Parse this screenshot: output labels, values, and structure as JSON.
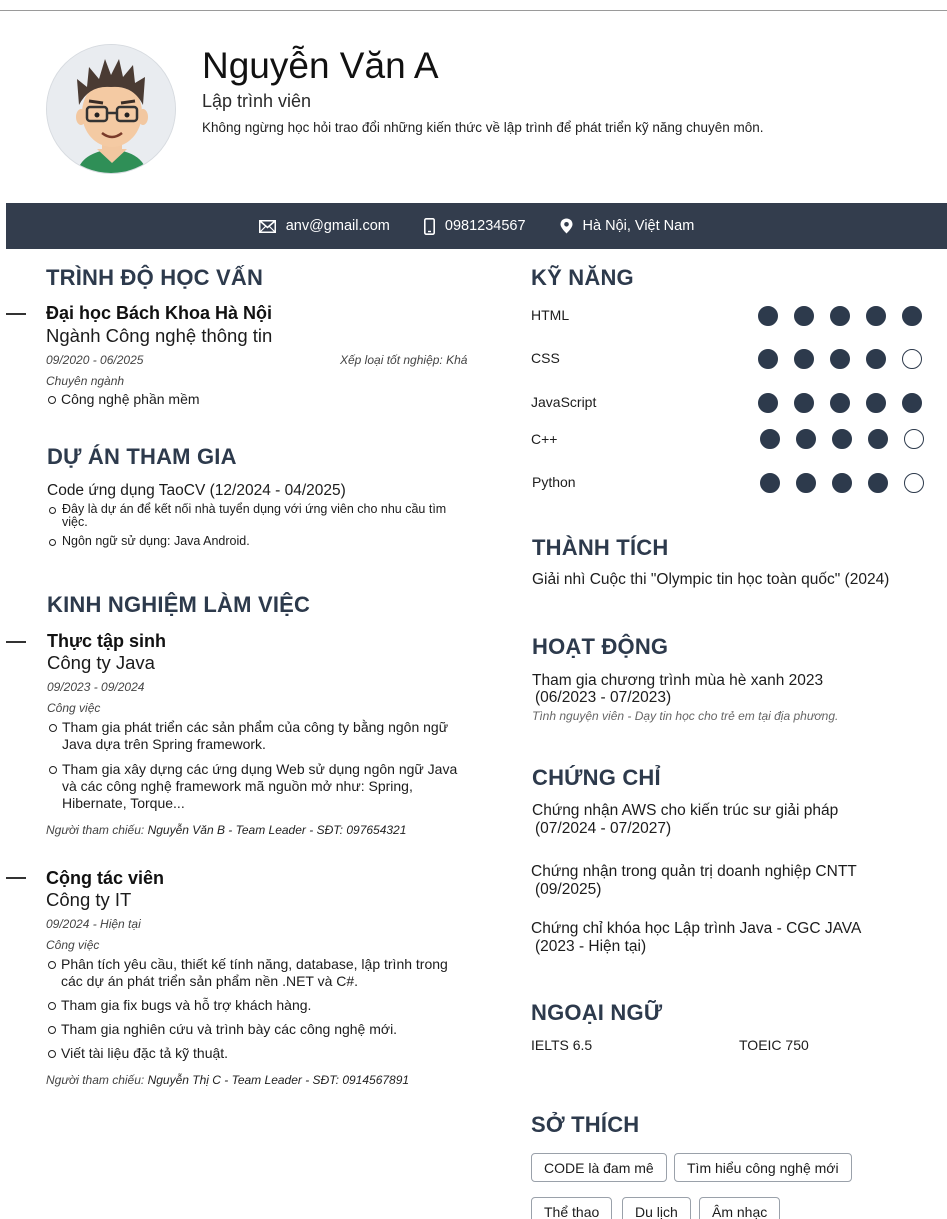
{
  "profile": {
    "name": "Nguyễn Văn A",
    "title": "Lập trình viên",
    "summary": "Không ngừng học hỏi trao đổi những kiến thức về lập trình để phát triển kỹ năng chuyên môn."
  },
  "contact": {
    "email": "anv@gmail.com",
    "phone": "0981234567",
    "location": "Hà Nội, Việt Nam",
    "email_icon": "mail-icon",
    "phone_icon": "phone-icon",
    "location_icon": "map-pin-icon"
  },
  "education": {
    "heading": "TRÌNH ĐỘ HỌC VẤN",
    "school": "Đại học Bách Khoa Hà Nội",
    "major": "Ngành Công nghệ thông tin",
    "period": "09/2020 - 06/2025",
    "grade": "Xếp loại tốt nghiệp: Khá",
    "specialty_label": "Chuyên ngành",
    "specialties": [
      "Công nghệ phần mềm"
    ]
  },
  "projects": {
    "heading": "DỰ ÁN THAM GIA",
    "items": [
      {
        "title": "Code ứng dụng TaoCV (12/2024 - 04/2025)",
        "bullets": [
          "Đây là dự án để kết nối nhà tuyển dụng với ứng viên cho nhu cầu tìm việc.",
          "Ngôn ngữ sử dụng: Java Android."
        ]
      }
    ]
  },
  "experience": {
    "heading": "KINH NGHIỆM LÀM VIỆC",
    "items": [
      {
        "position": "Thực tập sinh",
        "company": "Công ty Java",
        "period": "09/2023 - 09/2024",
        "work_label": "Công việc",
        "bullets": [
          "Tham gia phát triển các sản phẩm của công ty bằng ngôn ngữ Java dựa trên Spring framework.",
          "Tham gia xây dựng các ứng dụng Web sử dụng ngôn ngữ Java và các công nghệ framework mã nguồn mở như: Spring, Hibernate, Torque..."
        ],
        "ref_label": "Người tham chiếu:",
        "ref_value": "Nguyễn Văn B - Team Leader  -  SĐT: 097654321"
      },
      {
        "position": "Cộng tác viên",
        "company": "Công ty IT",
        "period": "09/2024 - Hiện tại",
        "work_label": "Công việc",
        "bullets": [
          "Phân tích yêu cầu, thiết kế tính năng, database, lập trình trong các dự án phát triển sản phẩm nền .NET và C#.",
          "Tham gia fix bugs và hỗ trợ khách hàng.",
          "Tham gia nghiên cứu và trình bày các công nghệ mới.",
          "Viết tài liệu đặc tả kỹ thuật."
        ],
        "ref_label": "Người tham chiếu:",
        "ref_value": "Nguyễn Thị C - Team Leader  -  SĐT: 0914567891"
      }
    ]
  },
  "skills": {
    "heading": "KỸ NĂNG",
    "items": [
      {
        "name": "HTML",
        "level": 5,
        "max": 5
      },
      {
        "name": "CSS",
        "level": 4,
        "max": 5
      },
      {
        "name": "JavaScript",
        "level": 5,
        "max": 5
      },
      {
        "name": "C++",
        "level": 4,
        "max": 5
      },
      {
        "name": "Python",
        "level": 4,
        "max": 5
      }
    ]
  },
  "awards": {
    "heading": "THÀNH TÍCH",
    "items": [
      "Giải nhì Cuộc thi \"Olympic tin học toàn quốc\" (2024)"
    ]
  },
  "activities": {
    "heading": "HOẠT ĐỘNG",
    "title": "Tham gia chương trình mùa hè xanh 2023",
    "period": "(06/2023 - 07/2023)",
    "detail": "Tình nguyện viên - Dạy tin học cho trẻ em tại địa phương."
  },
  "certificates": {
    "heading": "CHỨNG CHỈ",
    "items": [
      {
        "name": "Chứng nhận AWS cho kiến trúc sư giải pháp",
        "period": "(07/2024 - 07/2027)"
      },
      {
        "name": "Chứng nhận trong quản trị doanh nghiệp CNTT",
        "period": "(09/2025)"
      },
      {
        "name": "Chứng chỉ khóa học Lập trình Java - CGC JAVA",
        "period": "(2023 - Hiện tại)"
      }
    ]
  },
  "languages": {
    "heading": "NGOẠI NGỮ",
    "items": [
      "IELTS 6.5",
      "TOEIC 750"
    ]
  },
  "hobbies": {
    "heading": "SỞ THÍCH",
    "items": [
      "CODE là đam mê",
      "Tìm hiểu công nghệ mới",
      "Thể thao",
      "Du lịch",
      "Âm nhạc"
    ]
  },
  "colors": {
    "accent": "#2d3a4c",
    "contact_bar": "#333d4d"
  }
}
